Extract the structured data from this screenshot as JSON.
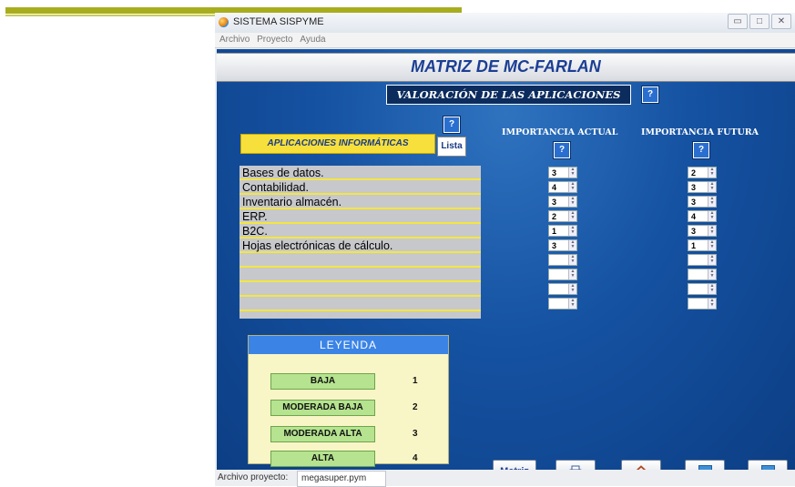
{
  "window": {
    "title": "SISTEMA SISPYME"
  },
  "menu": {
    "items": [
      "Archivo",
      "Proyecto",
      "Ayuda"
    ]
  },
  "header": {
    "title": "MATRIZ DE MC-FARLAN",
    "subtitle": "VALORACIÓN DE LAS APLICACIONES",
    "help_label": "?"
  },
  "apps_panel": {
    "label": "APLICACIONES INFORMÁTICAS",
    "list_button": "Lista",
    "help_label": "?",
    "items": [
      "Bases de datos.",
      "Contabilidad.",
      "Inventario almacén.",
      "ERP.",
      "B2C.",
      "Hojas electrónicas de cálculo.",
      "",
      "",
      "",
      ""
    ]
  },
  "columns": {
    "actual": {
      "label": "IMPORTANCIA ACTUAL",
      "help_label": "?",
      "values": [
        "3",
        "4",
        "3",
        "2",
        "1",
        "3",
        "",
        "",
        "",
        ""
      ]
    },
    "futura": {
      "label": "IMPORTANCIA FUTURA",
      "help_label": "?",
      "values": [
        "2",
        "3",
        "3",
        "4",
        "3",
        "1",
        "",
        "",
        "",
        ""
      ]
    }
  },
  "legend": {
    "title": "LEYENDA",
    "items": [
      {
        "label": "BAJA",
        "value": "1"
      },
      {
        "label": "MODERADA BAJA",
        "value": "2"
      },
      {
        "label": "MODERADA ALTA",
        "value": "3"
      },
      {
        "label": "ALTA",
        "value": "4"
      }
    ]
  },
  "toolbar": {
    "matriz_label": "Matriz",
    "print_icon": "printer-icon",
    "home_icon": "home-icon",
    "prev_icon": "arrow-left-icon",
    "next_icon": "arrow-right-icon"
  },
  "status": {
    "label": "Archivo proyecto:",
    "file": "megasuper.pym"
  }
}
